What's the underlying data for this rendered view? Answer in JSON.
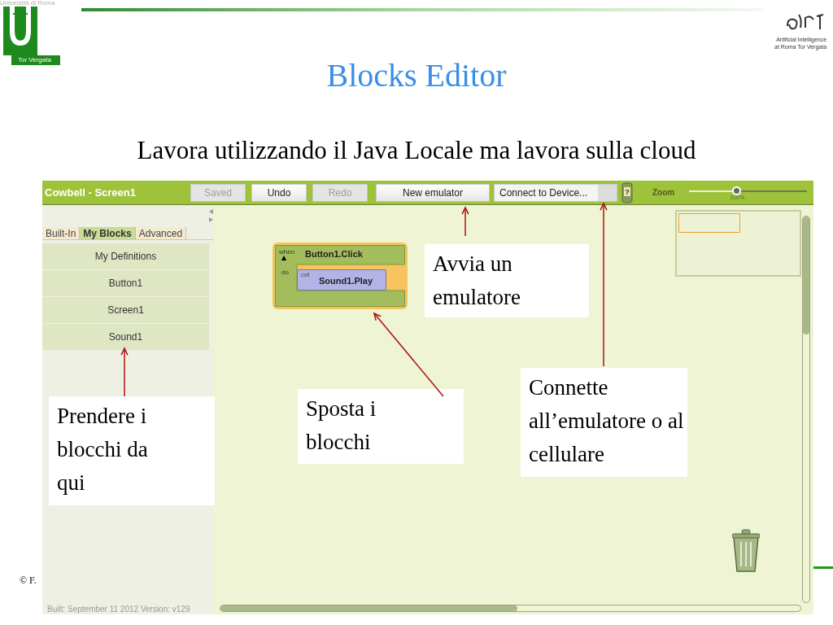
{
  "slide": {
    "university_logo": {
      "caption_top": "Università di Roma",
      "caption": "Tor Vergata"
    },
    "ai_logo": {
      "lines": [
        "Artificial Intelligence",
        "at Roma  Tor Vergata"
      ]
    },
    "title": "Blocks Editor",
    "subtitle": "Lavora utilizzando il Java Locale ma lavora sulla cloud",
    "footer_text": "© F."
  },
  "app": {
    "title": "Cowbell - Screen1",
    "toolbar_buttons": [
      {
        "label": "Saved",
        "disabled": true
      },
      {
        "label": "Undo",
        "disabled": false
      },
      {
        "label": "Redo",
        "disabled": true
      },
      {
        "label": "New emulator",
        "disabled": false
      }
    ],
    "connect_dropdown": "Connect to Device...",
    "help_glyph": "?",
    "zoom": {
      "label": "Zoom",
      "level": 0.4,
      "reading": "100%"
    },
    "tabs": [
      {
        "label": "Built-In",
        "selected": false
      },
      {
        "label": "My Blocks",
        "selected": true
      },
      {
        "label": "Advanced",
        "selected": false
      }
    ],
    "drawers": [
      "My Definitions",
      "Button1",
      "Screen1",
      "Sound1"
    ],
    "block": {
      "event_prefix": "when",
      "event": "Button1.Click",
      "do_label": "do",
      "call_prefix": "call",
      "call": "Sound1.Play"
    },
    "version": "Built: September 11 2012 Version: v129"
  },
  "callouts": [
    {
      "text": "Avvia un emulatore"
    },
    {
      "text": "Prendere i blocchi da qui"
    },
    {
      "text": "Sposta i blocchi"
    },
    {
      "text": "Connette all’emulatore o al cellulare"
    }
  ]
}
